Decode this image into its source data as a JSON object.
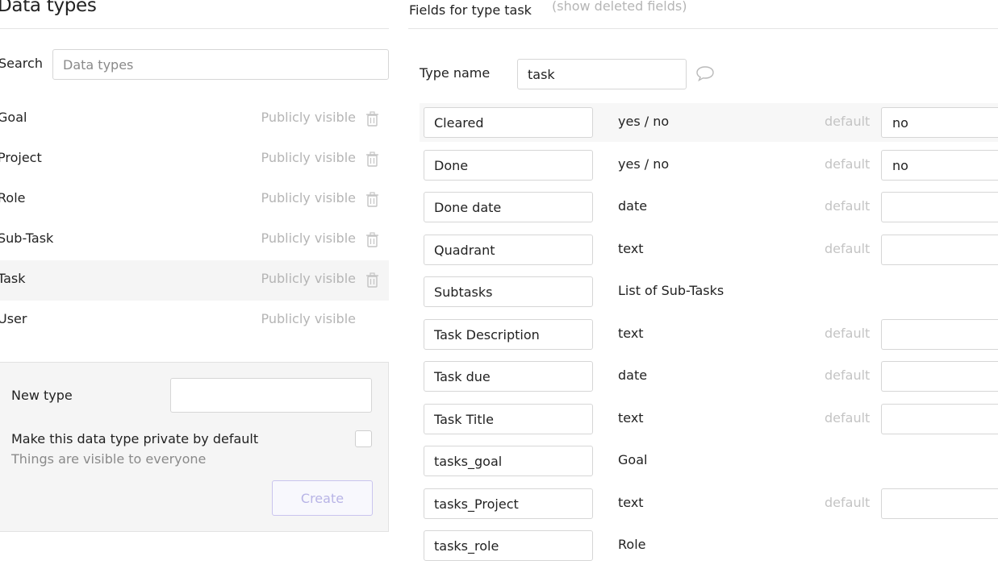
{
  "left": {
    "title": "Data types",
    "search": {
      "label": "Search",
      "placeholder": "Data types",
      "value": ""
    },
    "types": [
      {
        "name": "Goal",
        "visibility": "Publicly visible",
        "deletable": true,
        "selected": false
      },
      {
        "name": "Project",
        "visibility": "Publicly visible",
        "deletable": true,
        "selected": false
      },
      {
        "name": "Role",
        "visibility": "Publicly visible",
        "deletable": true,
        "selected": false
      },
      {
        "name": "Sub-Task",
        "visibility": "Publicly visible",
        "deletable": true,
        "selected": false
      },
      {
        "name": "Task",
        "visibility": "Publicly visible",
        "deletable": true,
        "selected": true
      },
      {
        "name": "User",
        "visibility": "Publicly visible",
        "deletable": false,
        "selected": false
      }
    ],
    "new_type": {
      "label": "New type",
      "value": "",
      "private_label": "Make this data type private by default",
      "private_sub": "Things are visible to everyone",
      "private_checked": false,
      "create_label": "Create"
    }
  },
  "right": {
    "title": "Fields for type task",
    "show_deleted": "(show deleted fields)",
    "type_name_label": "Type name",
    "type_name_value": "task",
    "default_label": "default",
    "fields": [
      {
        "name": "Cleared",
        "type": "yes / no",
        "has_default": true,
        "default": "no"
      },
      {
        "name": "Done",
        "type": "yes / no",
        "has_default": true,
        "default": "no"
      },
      {
        "name": "Done date",
        "type": "date",
        "has_default": true,
        "default": ""
      },
      {
        "name": "Quadrant",
        "type": "text",
        "has_default": true,
        "default": ""
      },
      {
        "name": "Subtasks",
        "type": "List of Sub-Tasks",
        "has_default": false,
        "default": ""
      },
      {
        "name": "Task Description",
        "type": "text",
        "has_default": true,
        "default": ""
      },
      {
        "name": "Task due",
        "type": "date",
        "has_default": true,
        "default": ""
      },
      {
        "name": "Task Title",
        "type": "text",
        "has_default": true,
        "default": ""
      },
      {
        "name": "tasks_goal",
        "type": "Goal",
        "has_default": false,
        "default": ""
      },
      {
        "name": "tasks_Project",
        "type": "text",
        "has_default": true,
        "default": ""
      },
      {
        "name": "tasks_role",
        "type": "Role",
        "has_default": false,
        "default": ""
      }
    ]
  },
  "icons": {
    "delete": "trash-icon",
    "comment": "speech-bubble-icon"
  },
  "colors": {
    "accent": "#c9c4ee",
    "muted": "#b5b5b5",
    "selected_row": "#f5f5f5"
  }
}
